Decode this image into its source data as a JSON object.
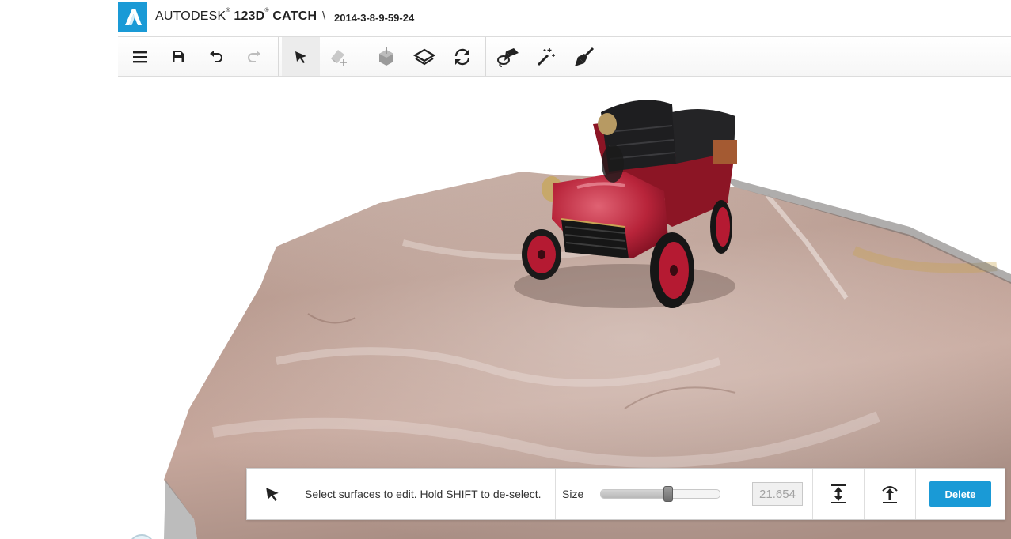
{
  "app": {
    "brand_name": "AUTODESK",
    "brand_product": "123D",
    "brand_product_suffix": "CATCH",
    "trademark": "®",
    "separator": "\\",
    "project_name": "2014-3-8-9-59-24",
    "accent_color": "#1a9ad6",
    "notification_color": "#e0141e"
  },
  "toolbar": {
    "items": [
      {
        "name": "menu",
        "icon": "hamburger-menu-icon"
      },
      {
        "name": "save",
        "icon": "save-icon"
      },
      {
        "name": "undo",
        "icon": "undo-icon"
      },
      {
        "name": "redo",
        "icon": "redo-icon",
        "state": "disabled"
      },
      {
        "name": "select",
        "icon": "select-arrow-icon",
        "state": "active"
      },
      {
        "name": "erase-add",
        "icon": "eraser-add-icon",
        "state": "disabled"
      },
      {
        "name": "solidify",
        "icon": "solid-cube-icon",
        "state": "disabled"
      },
      {
        "name": "layers",
        "icon": "layers-icon"
      },
      {
        "name": "refresh",
        "icon": "rotate-icon"
      },
      {
        "name": "lasso",
        "icon": "lasso-select-icon"
      },
      {
        "name": "magic-wand",
        "icon": "magic-wand-icon"
      },
      {
        "name": "paint-brush",
        "icon": "paint-brush-icon"
      }
    ]
  },
  "viewport": {
    "scene": "3D capture of a red vintage toy car on a marble slab"
  },
  "edit_panel": {
    "message": "Select surfaces to edit. Hold SHIFT to de-select.",
    "size_label": "Size",
    "size_value": "21.654",
    "slider_level": 0.57,
    "delete_label": "Delete"
  }
}
